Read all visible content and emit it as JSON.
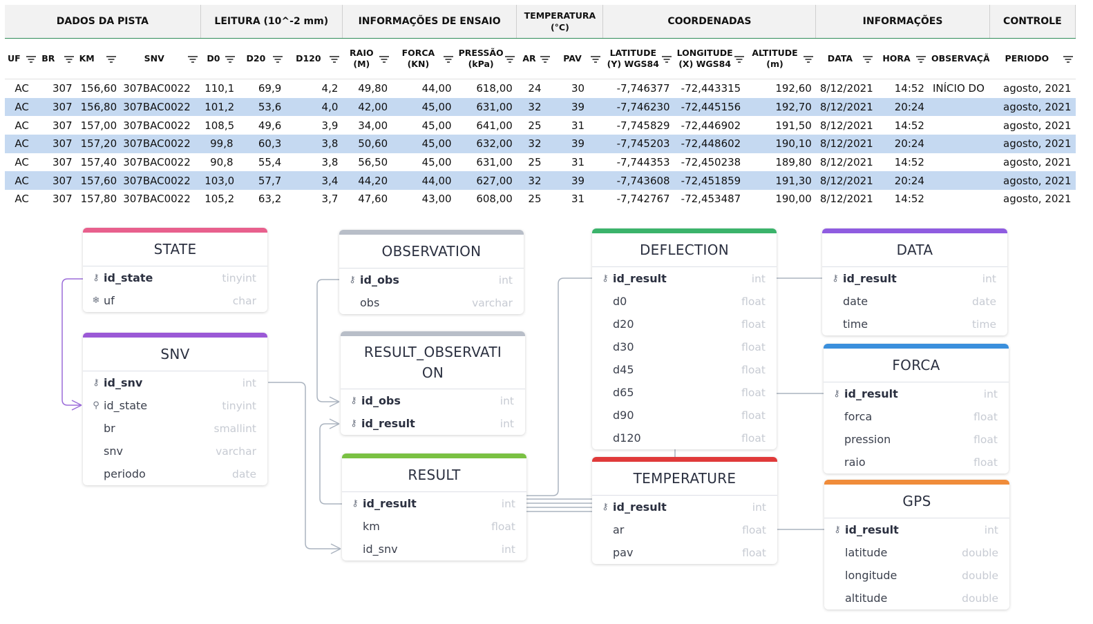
{
  "sheet": {
    "groups": [
      {
        "label": "DADOS DA PISTA"
      },
      {
        "label": "LEITURA (10^-2 mm)"
      },
      {
        "label": "INFORMAÇÕES DE ENSAIO"
      },
      {
        "label": "TEMPERATURA (°C)"
      },
      {
        "label": "COORDENADAS"
      },
      {
        "label": "INFORMAÇÕES"
      },
      {
        "label": "CONTROLE"
      }
    ],
    "columns": [
      "UF",
      "BR",
      "KM",
      "SNV",
      "D0",
      "D20",
      "D120",
      "RAIO (M)",
      "FORCA (KN)",
      "PRESSÃO (kPa)",
      "AR",
      "PAV",
      "LATITUDE (Y) WGS84",
      "LONGITUDE (X) WGS84",
      "ALTITUDE (m)",
      "DATA",
      "HORA",
      "OBSERVAÇÃO",
      "PERIODO"
    ],
    "rows": [
      [
        "AC",
        "307",
        "156,60",
        "307BAC0022",
        "110,1",
        "69,9",
        "4,2",
        "49,80",
        "44,00",
        "618,00",
        "24",
        "30",
        "-7,746377",
        "-72,443315",
        "192,60",
        "8/12/2021",
        "14:52",
        "INÍCIO DO",
        "agosto, 2021"
      ],
      [
        "AC",
        "307",
        "156,80",
        "307BAC0022",
        "101,2",
        "53,6",
        "4,0",
        "42,00",
        "45,00",
        "631,00",
        "32",
        "39",
        "-7,746230",
        "-72,445156",
        "192,70",
        "8/12/2021",
        "20:24",
        "",
        "agosto, 2021"
      ],
      [
        "AC",
        "307",
        "157,00",
        "307BAC0022",
        "108,5",
        "49,6",
        "3,9",
        "34,00",
        "45,00",
        "641,00",
        "25",
        "31",
        "-7,745829",
        "-72,446902",
        "191,50",
        "8/12/2021",
        "14:52",
        "",
        "agosto, 2021"
      ],
      [
        "AC",
        "307",
        "157,20",
        "307BAC0022",
        "99,8",
        "60,3",
        "3,8",
        "50,60",
        "45,00",
        "632,00",
        "32",
        "39",
        "-7,745203",
        "-72,448602",
        "190,10",
        "8/12/2021",
        "20:24",
        "",
        "agosto, 2021"
      ],
      [
        "AC",
        "307",
        "157,40",
        "307BAC0022",
        "90,8",
        "55,4",
        "3,8",
        "56,50",
        "45,00",
        "631,00",
        "25",
        "31",
        "-7,744353",
        "-72,450238",
        "189,80",
        "8/12/2021",
        "14:52",
        "",
        "agosto, 2021"
      ],
      [
        "AC",
        "307",
        "157,60",
        "307BAC0022",
        "103,0",
        "57,7",
        "3,4",
        "44,20",
        "44,00",
        "627,00",
        "32",
        "39",
        "-7,743608",
        "-72,451859",
        "191,30",
        "8/12/2021",
        "20:24",
        "",
        "agosto, 2021"
      ],
      [
        "AC",
        "307",
        "157,80",
        "307BAC0022",
        "105,2",
        "63,2",
        "3,7",
        "47,60",
        "43,00",
        "608,00",
        "25",
        "31",
        "-7,742767",
        "-72,453487",
        "190,00",
        "8/12/2021",
        "14:52",
        "",
        "agosto, 2021"
      ]
    ],
    "row_highlight": "#c5d9f1"
  },
  "er": {
    "tables": [
      {
        "name": "STATE",
        "color": "#e8608d",
        "fields": [
          {
            "name": "id_state",
            "type": "tinyint",
            "key": "pk"
          },
          {
            "name": "uf",
            "type": "char",
            "key": "snow"
          }
        ]
      },
      {
        "name": "SNV",
        "color": "#9b59d6",
        "fields": [
          {
            "name": "id_snv",
            "type": "int",
            "key": "pk"
          },
          {
            "name": "id_state",
            "type": "tinyint",
            "key": "fk"
          },
          {
            "name": "br",
            "type": "smallint",
            "key": ""
          },
          {
            "name": "snv",
            "type": "varchar",
            "key": ""
          },
          {
            "name": "periodo",
            "type": "date",
            "key": ""
          }
        ]
      },
      {
        "name": "OBSERVATION",
        "color": "#b8bec8",
        "fields": [
          {
            "name": "id_obs",
            "type": "int",
            "key": "pk"
          },
          {
            "name": "obs",
            "type": "varchar",
            "key": ""
          }
        ]
      },
      {
        "name": "RESULT_OBSERVATION",
        "color": "#b8bec8",
        "fields": [
          {
            "name": "id_obs",
            "type": "int",
            "key": "pk"
          },
          {
            "name": "id_result",
            "type": "int",
            "key": "pk"
          }
        ]
      },
      {
        "name": "RESULT",
        "color": "#7ac143",
        "fields": [
          {
            "name": "id_result",
            "type": "int",
            "key": "pk"
          },
          {
            "name": "km",
            "type": "float",
            "key": ""
          },
          {
            "name": "id_snv",
            "type": "int",
            "key": ""
          }
        ]
      },
      {
        "name": "DEFLECTION",
        "color": "#3bb36b",
        "fields": [
          {
            "name": "id_result",
            "type": "int",
            "key": "pk"
          },
          {
            "name": "d0",
            "type": "float",
            "key": ""
          },
          {
            "name": "d20",
            "type": "float",
            "key": ""
          },
          {
            "name": "d30",
            "type": "float",
            "key": ""
          },
          {
            "name": "d45",
            "type": "float",
            "key": ""
          },
          {
            "name": "d65",
            "type": "float",
            "key": ""
          },
          {
            "name": "d90",
            "type": "float",
            "key": ""
          },
          {
            "name": "d120",
            "type": "float",
            "key": ""
          }
        ]
      },
      {
        "name": "TEMPERATURE",
        "color": "#e03a3a",
        "fields": [
          {
            "name": "id_result",
            "type": "int",
            "key": "pk"
          },
          {
            "name": "ar",
            "type": "float",
            "key": ""
          },
          {
            "name": "pav",
            "type": "float",
            "key": ""
          }
        ]
      },
      {
        "name": "DATA",
        "color": "#8f5ce0",
        "fields": [
          {
            "name": "id_result",
            "type": "int",
            "key": "pk"
          },
          {
            "name": "date",
            "type": "date",
            "key": ""
          },
          {
            "name": "time",
            "type": "time",
            "key": ""
          }
        ]
      },
      {
        "name": "FORCA",
        "color": "#3a8fdc",
        "fields": [
          {
            "name": "id_result",
            "type": "int",
            "key": "pk"
          },
          {
            "name": "forca",
            "type": "float",
            "key": ""
          },
          {
            "name": "pression",
            "type": "float",
            "key": ""
          },
          {
            "name": "raio",
            "type": "float",
            "key": ""
          }
        ]
      },
      {
        "name": "GPS",
        "color": "#f08c3a",
        "fields": [
          {
            "name": "id_result",
            "type": "int",
            "key": "pk"
          },
          {
            "name": "latitude",
            "type": "double",
            "key": ""
          },
          {
            "name": "longitude",
            "type": "double",
            "key": ""
          },
          {
            "name": "altitude",
            "type": "double",
            "key": ""
          }
        ]
      }
    ]
  }
}
